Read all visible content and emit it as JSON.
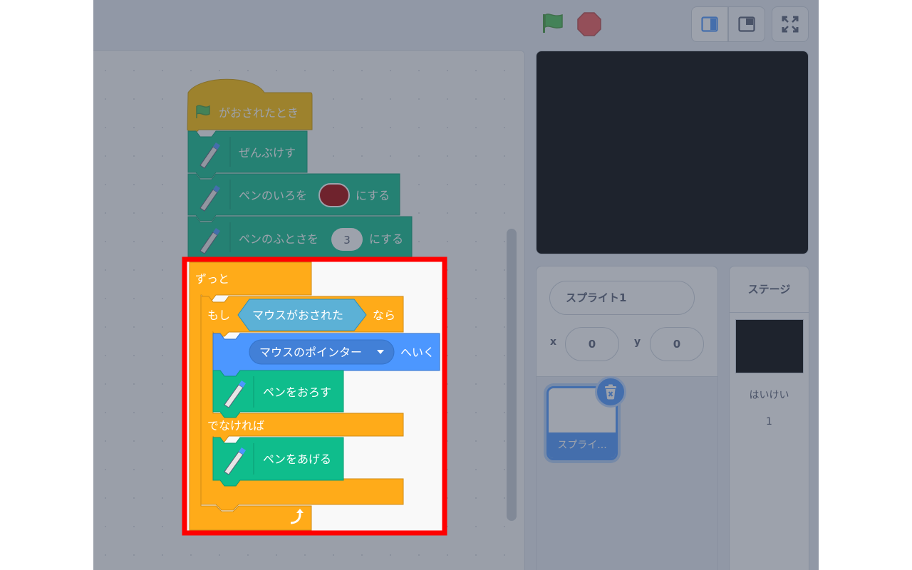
{
  "controls": {
    "green_flag": "green-flag-icon",
    "stop": "stop-icon",
    "layout_small": "small-stage-icon",
    "layout_large": "large-stage-icon",
    "fullscreen": "fullscreen-icon"
  },
  "script": {
    "hat_label": "がおされたとき",
    "clear_label": "ぜんぶけす",
    "set_color_label": "ペンのいろを",
    "set_color_suffix": "にする",
    "pen_color": "#a30000",
    "set_size_label": "ペンのふとさを",
    "pen_size": "3",
    "set_size_suffix": "にする",
    "forever_label": "ずっと",
    "if_label": "もし",
    "condition_label": "マウスがおされた",
    "then_label": "なら",
    "goto_menu_value": "マウスのポインター",
    "goto_suffix": "へいく",
    "pen_down_label": "ペンをおろす",
    "else_label": "でなければ",
    "pen_up_label": "ペンをあげる"
  },
  "sprite_info": {
    "name": "スプライト1",
    "x_label": "x",
    "x_value": "0",
    "y_label": "y",
    "y_value": "0"
  },
  "sprite_list": [
    {
      "name": "スプライ..."
    }
  ],
  "stage_panel": {
    "title": "ステージ",
    "backdrops_label": "はいけい",
    "backdrops_count": "1"
  },
  "colors": {
    "highlight_border": "#ff0000",
    "events": "#ffbf00",
    "control": "#ffab19",
    "pen": "#0fbd8c",
    "motion": "#4c97ff",
    "sensing": "#5cb1d6"
  }
}
